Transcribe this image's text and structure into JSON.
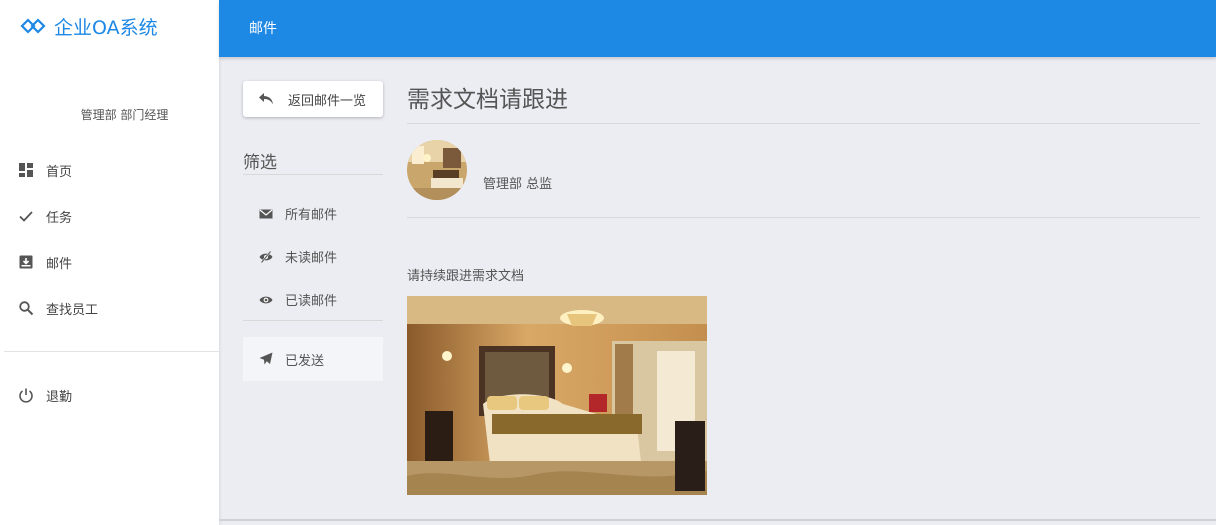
{
  "app": {
    "name": "企业OA系统"
  },
  "user": {
    "info": "管理部 部门经理"
  },
  "sidebar": {
    "items": [
      {
        "label": "首页",
        "icon": "dashboard-icon"
      },
      {
        "label": "任务",
        "icon": "check-icon"
      },
      {
        "label": "邮件",
        "icon": "inbox-icon"
      },
      {
        "label": "查找员工",
        "icon": "search-icon"
      }
    ],
    "logout": {
      "label": "退勤",
      "icon": "power-icon"
    }
  },
  "header": {
    "title": "邮件"
  },
  "back_button": {
    "label": "返回邮件一览",
    "icon": "reply-icon"
  },
  "filter": {
    "title": "筛选",
    "items": [
      {
        "label": "所有邮件",
        "icon": "envelope-icon"
      },
      {
        "label": "未读邮件",
        "icon": "eye-slash-icon"
      },
      {
        "label": "已读邮件",
        "icon": "eye-icon"
      }
    ],
    "sent": {
      "label": "已发送",
      "icon": "paper-plane-icon"
    }
  },
  "mail": {
    "subject": "需求文档请跟进",
    "sender": "管理部 总监",
    "body": "请持续跟进需求文档"
  },
  "colors": {
    "primary": "#1e88e5",
    "background": "#ecedf3"
  }
}
